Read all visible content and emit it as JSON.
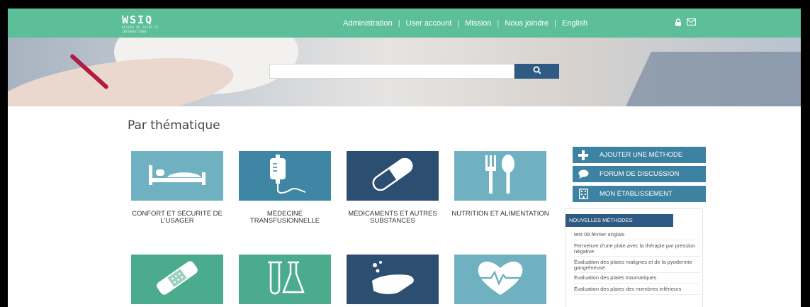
{
  "header": {
    "logo_text": "WSIQ",
    "logo_tagline": "RÉSEAU DE SOINS ET INFORMATIONS",
    "nav": [
      {
        "label": "Administration"
      },
      {
        "label": "User account"
      },
      {
        "label": "Mission"
      },
      {
        "label": "Nous joindre"
      },
      {
        "label": "English"
      }
    ],
    "icons": [
      "lock-icon",
      "mail-icon"
    ]
  },
  "search": {
    "placeholder": "",
    "button_icon": "search-icon"
  },
  "section_title": "Par thématique",
  "tiles": [
    {
      "label": "CONFORT ET SÉCURITÉ DE L'USAGER",
      "icon": "bed-icon",
      "color": "#6fb1c1"
    },
    {
      "label": "MÉDECINE TRANSFUSIONNELLE",
      "icon": "iv-bag-icon",
      "color": "#3f86a4"
    },
    {
      "label": "MÉDICAMENTS ET AUTRES SUBSTANCES",
      "icon": "pill-icon",
      "color": "#2c4e70"
    },
    {
      "label": "NUTRITION ET ALIMENTATION",
      "icon": "fork-spoon-icon",
      "color": "#6fb1c1"
    },
    {
      "label": "",
      "icon": "bandage-icon",
      "color": "#4aac8d"
    },
    {
      "label": "",
      "icon": "lab-flask-icon",
      "color": "#4aac8d"
    },
    {
      "label": "",
      "icon": "hand-wash-icon",
      "color": "#2c4e70"
    },
    {
      "label": "",
      "icon": "heart-pulse-icon",
      "color": "#6fb1c1"
    }
  ],
  "side_buttons": [
    {
      "label": "AJOUTER UNE MÉTHODE",
      "icon": "plus-icon"
    },
    {
      "label": "FORUM DE DISCUSSION",
      "icon": "chat-bubble-icon"
    },
    {
      "label": "MON ÉTABLISSEMENT",
      "icon": "building-icon"
    }
  ],
  "news": {
    "title": "NOUVELLES MÉTHODES",
    "items": [
      "test 08 février anglais",
      "Fermeture d'une plaie avec la thérapie par pression négative",
      "Évaluation des plaies malignes et de la pyodermie gangréneuse",
      "Évaluation des plaies traumatiques",
      "Évaluation des plaies des membres inférieurs"
    ]
  },
  "colors": {
    "topbar": "#5cbf9a",
    "navy": "#2e5a83",
    "button_blue": "#3e82a2"
  }
}
